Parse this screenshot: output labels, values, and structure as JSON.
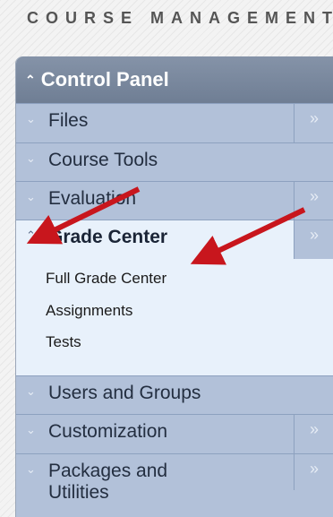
{
  "section_heading": "COURSE MANAGEMENT",
  "control_panel": {
    "title": "Control Panel",
    "items": [
      {
        "label": "Files"
      },
      {
        "label": "Course Tools"
      },
      {
        "label": "Evaluation"
      },
      {
        "label": "Grade Center",
        "subitems": [
          "Full Grade Center",
          "Assignments",
          "Tests"
        ]
      },
      {
        "label": "Users and Groups"
      },
      {
        "label": "Customization"
      },
      {
        "label": "Packages and Utilities"
      }
    ]
  },
  "icons": {
    "collapse": "double-chevron-up-icon",
    "expand_section": "double-chevron-down-icon",
    "open_menu": "double-chevron-right-icon",
    "annotation": "red-arrow-icon"
  },
  "colors": {
    "header": "#7a889d",
    "row": "#b2c1d9",
    "active_row": "#e8f1fb",
    "annotation_arrow": "#c8161d"
  }
}
